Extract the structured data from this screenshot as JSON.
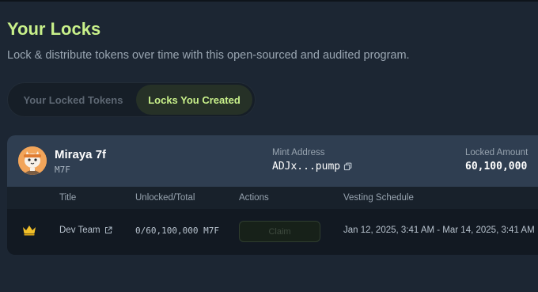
{
  "header": {
    "title": "Your Locks",
    "subtitle": "Lock & distribute tokens over time with this open-sourced and audited program."
  },
  "tabs": [
    {
      "label": "Your Locked Tokens",
      "active": false
    },
    {
      "label": "Locks You Created",
      "active": true
    }
  ],
  "token": {
    "name": "Miraya 7f",
    "symbol": "M7F",
    "mint_label": "Mint Address",
    "mint_value": "ADJx...pump",
    "locked_label": "Locked Amount",
    "locked_value": "60,100,000",
    "avatar_icon": "cat-avatar"
  },
  "table": {
    "headers": [
      "Title",
      "Unlocked/Total",
      "Actions",
      "Vesting Schedule"
    ],
    "rows": [
      {
        "icon": "crown-icon",
        "title": "Dev Team",
        "unlocked": "0/60,100,000 M7F",
        "action": "Claim",
        "vesting": "Jan 12, 2025, 3:41 AM - Mar 14, 2025, 3:41 AM"
      }
    ]
  },
  "colors": {
    "accent": "#c8f08a",
    "background": "#1c2633",
    "card_head": "#2f3e51"
  }
}
